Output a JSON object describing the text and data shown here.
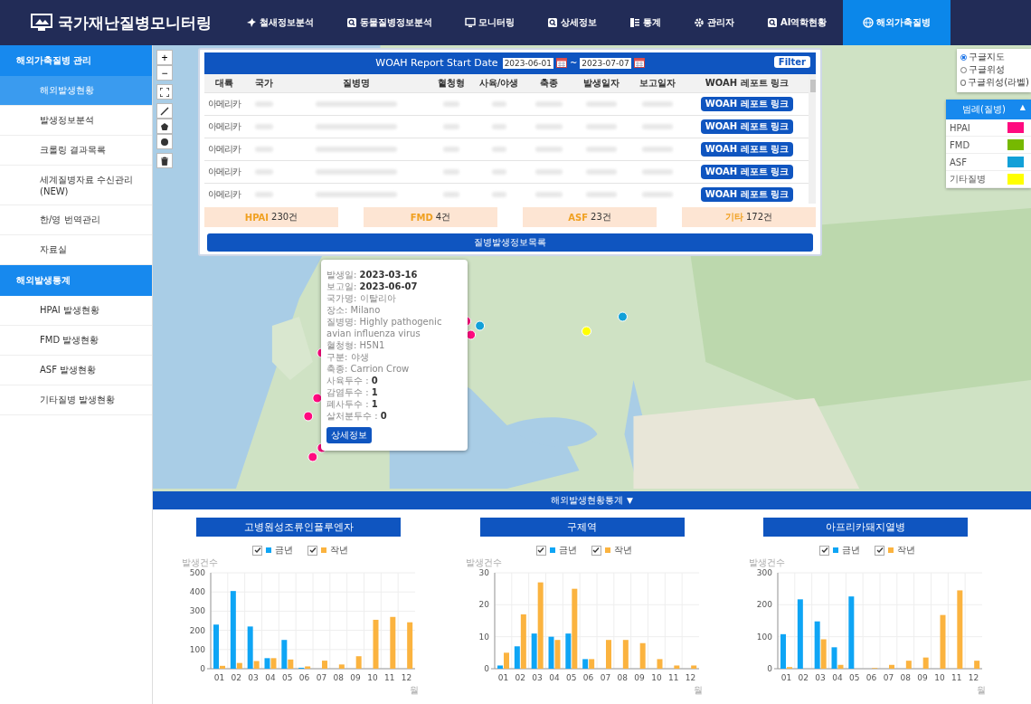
{
  "header": {
    "title": "국가재난질병모니터링",
    "nav": [
      {
        "label": "철새정보분석",
        "selected": false
      },
      {
        "label": "동물질병정보분석",
        "selected": false
      },
      {
        "label": "모니터링",
        "selected": false
      },
      {
        "label": "상세정보",
        "selected": false
      },
      {
        "label": "통계",
        "selected": false
      },
      {
        "label": "관리자",
        "selected": false
      },
      {
        "label": "AI역학현황",
        "selected": false
      },
      {
        "label": "해외가축질병",
        "selected": true
      }
    ]
  },
  "sidebar": {
    "sections": [
      {
        "title": "해외가축질병 관리",
        "items": [
          {
            "label": "해외발생현황",
            "selected": true
          },
          {
            "label": "발생정보분석",
            "selected": false
          },
          {
            "label": "크롤링 결과목록",
            "selected": false
          },
          {
            "label": "세계질병자료 수신관리\n(NEW)",
            "selected": false
          },
          {
            "label": "한/영 번역관리",
            "selected": false
          },
          {
            "label": "자료실",
            "selected": false
          }
        ]
      },
      {
        "title": "해외발생통계",
        "items": [
          {
            "label": "HPAI 발생현황",
            "selected": false
          },
          {
            "label": "FMD 발생현황",
            "selected": false
          },
          {
            "label": "ASF 발생현황",
            "selected": false
          },
          {
            "label": "기타질병 발생현황",
            "selected": false
          }
        ]
      }
    ]
  },
  "map": {
    "zoom_in": "+",
    "zoom_out": "−",
    "layer_options": [
      {
        "label": "구글지도",
        "selected": true
      },
      {
        "label": "구글위성",
        "selected": false
      },
      {
        "label": "구글위성(라벨)",
        "selected": false
      }
    ],
    "legend": {
      "title": "범례(질병)",
      "toggle": "▲",
      "items": [
        {
          "label": "HPAI",
          "color": "#ff0a7f"
        },
        {
          "label": "FMD",
          "color": "#76b900"
        },
        {
          "label": "ASF",
          "color": "#12a0d8"
        },
        {
          "label": "기타질병",
          "color": "#ffff00"
        }
      ]
    },
    "popup": {
      "lines": [
        "발생일: **2023-03-16**",
        "보고일: **2023-06-07**",
        "국가명: 이탈리아",
        "장소: Milano",
        "질병명: Highly pathogenic avian influenza virus",
        "혈청형: H5N1",
        "구분: 야생",
        "축종: Carrion Crow",
        "사육두수 : **0**",
        "감염두수 : **1**",
        "폐사두수 : **1**",
        "살처분두수 : **0**"
      ],
      "button": "상세정보"
    }
  },
  "report_panel": {
    "title": "WOAH Report Start Date",
    "start_date": "2023-06-01",
    "tilde": "~",
    "end_date": "2023-07-07",
    "filter_button": "Filter",
    "columns": [
      "대륙",
      "국가",
      "질병명",
      "혈청형",
      "사육/야생",
      "축종",
      "발생일자",
      "보고일자",
      "WOAH 레포트 링크"
    ],
    "rows": [
      {
        "region": "아메리카",
        "link": "WOAH 레포트 링크"
      },
      {
        "region": "아메리카",
        "link": "WOAH 레포트 링크"
      },
      {
        "region": "아메리카",
        "link": "WOAH 레포트 링크"
      },
      {
        "region": "아메리카",
        "link": "WOAH 레포트 링크"
      },
      {
        "region": "아메리카",
        "link": "WOAH 레포트 링크"
      }
    ],
    "summary": [
      {
        "label": "HPAI",
        "count": "230건"
      },
      {
        "label": "FMD",
        "count": "4건"
      },
      {
        "label": "ASF",
        "count": "23건"
      },
      {
        "label": "기타",
        "count": "172건"
      }
    ],
    "list_button": "질병발생정보목록"
  },
  "stats": {
    "title": "해외발생현황통계",
    "toggle": "▼",
    "charts": [
      {
        "title": "고병원성조류인플루엔자",
        "legend": [
          {
            "checked": true
          },
          {
            "checked": true
          }
        ],
        "chart_data": {
          "type": "bar",
          "grid": true,
          "ylabel": "발생건수",
          "xlabel": "월",
          "categories": [
            "01",
            "02",
            "03",
            "04",
            "05",
            "06",
            "07",
            "08",
            "09",
            "10",
            "11",
            "12"
          ],
          "series": [
            {
              "name": "금년",
              "color": "#0ea5f5",
              "values": [
                230,
                405,
                220,
                55,
                150,
                5,
                0,
                0,
                0,
                0,
                0,
                0
              ]
            },
            {
              "name": "작년",
              "color": "#fbb33f",
              "values": [
                15,
                30,
                40,
                55,
                48,
                12,
                42,
                22,
                65,
                255,
                270,
                242
              ]
            }
          ],
          "ylim": [
            0,
            500
          ],
          "yticks": [
            0,
            100,
            200,
            300,
            400,
            500
          ]
        }
      },
      {
        "title": "구제역",
        "legend": [
          {
            "checked": true
          },
          {
            "checked": true
          }
        ],
        "chart_data": {
          "type": "bar",
          "grid": true,
          "ylabel": "발생건수",
          "xlabel": "월",
          "categories": [
            "01",
            "02",
            "03",
            "04",
            "05",
            "06",
            "07",
            "08",
            "09",
            "10",
            "11",
            "12"
          ],
          "series": [
            {
              "name": "금년",
              "color": "#0ea5f5",
              "values": [
                1,
                7,
                11,
                10,
                11,
                3,
                0,
                0,
                0,
                0,
                0,
                0
              ]
            },
            {
              "name": "작년",
              "color": "#fbb33f",
              "values": [
                5,
                17,
                27,
                9,
                25,
                3,
                9,
                9,
                8,
                3,
                1,
                1
              ]
            }
          ],
          "ylim": [
            0,
            30
          ],
          "yticks": [
            0,
            10,
            20,
            30
          ]
        }
      },
      {
        "title": "아프리카돼지열병",
        "legend": [
          {
            "checked": true
          },
          {
            "checked": true
          }
        ],
        "chart_data": {
          "type": "bar",
          "grid": true,
          "ylabel": "발생건수",
          "xlabel": "월",
          "categories": [
            "01",
            "02",
            "03",
            "04",
            "05",
            "06",
            "07",
            "08",
            "09",
            "10",
            "11",
            "12"
          ],
          "series": [
            {
              "name": "금년",
              "color": "#0ea5f5",
              "values": [
                108,
                217,
                148,
                67,
                226,
                0,
                0,
                0,
                0,
                0,
                0,
                0
              ]
            },
            {
              "name": "작년",
              "color": "#fbb33f",
              "values": [
                5,
                0,
                92,
                12,
                0,
                2,
                12,
                25,
                35,
                168,
                245,
                25
              ]
            }
          ],
          "ylim": [
            0,
            300
          ],
          "yticks": [
            0,
            100,
            200,
            300
          ]
        }
      }
    ]
  }
}
